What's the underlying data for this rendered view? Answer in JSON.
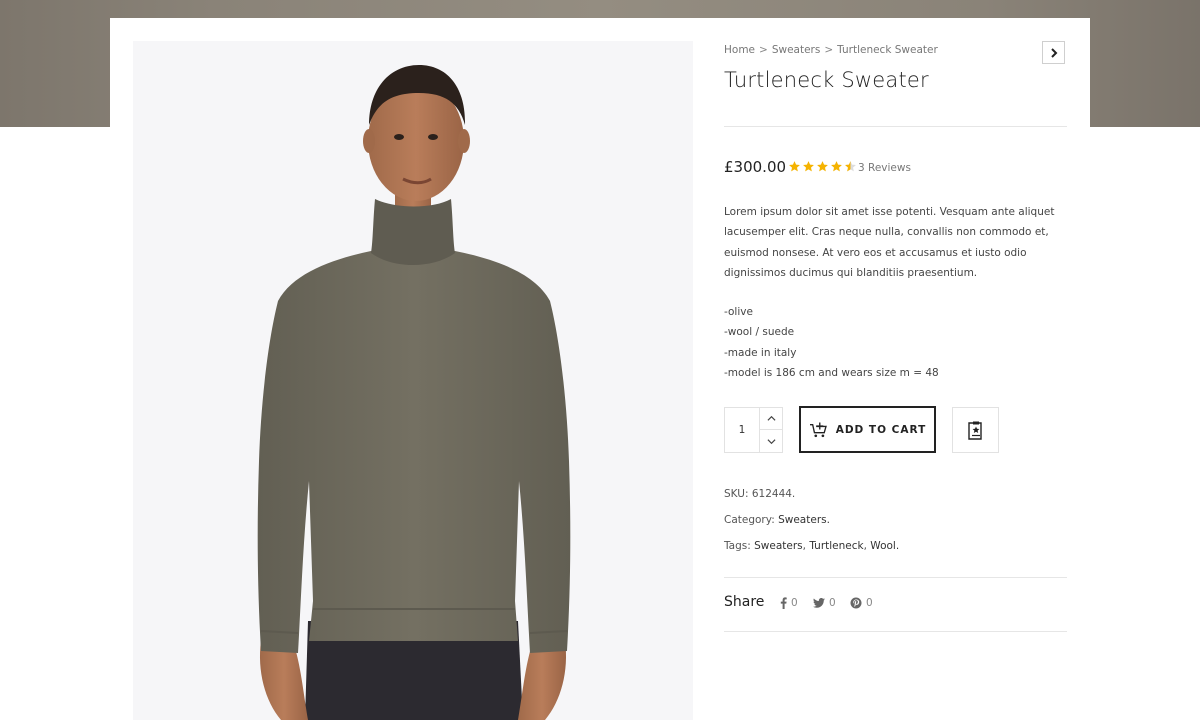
{
  "breadcrumb": {
    "items": [
      "Home",
      "Sweaters",
      "Turtleneck Sweater"
    ],
    "separator": ">"
  },
  "product": {
    "title": "Turtleneck Sweater",
    "price": "£300.00",
    "rating": 4.5,
    "rating_max": 5,
    "reviews": "3 Reviews",
    "description": "Lorem ipsum dolor sit amet isse potenti. Vesquam ante aliquet lacusemper elit. Cras neque nulla, convallis non commodo et, euismod nonsese. At vero eos et accusamus et iusto odio dignissimos ducimus qui blanditiis praesentium.",
    "features": [
      "-olive",
      "-wool / suede",
      "-made in italy",
      "-model is 186 cm and wears size m = 48"
    ],
    "quantity": "1",
    "add_to_cart_label": "ADD TO CART",
    "sku_label": "SKU:",
    "sku": "612444.",
    "category_label": "Category:",
    "category": "Sweaters.",
    "tags_label": "Tags:",
    "tags": [
      "Sweaters",
      "Turtleneck",
      "Wool."
    ]
  },
  "share": {
    "label": "Share",
    "facebook_count": "0",
    "twitter_count": "0",
    "pinterest_count": "0"
  },
  "icons": {
    "next": "chevron-right-icon",
    "cart": "cart-plus-icon",
    "wishlist": "clipboard-star-icon",
    "facebook": "facebook-icon",
    "twitter": "twitter-icon",
    "pinterest": "pinterest-icon"
  },
  "colors": {
    "star": "#f5b301",
    "sweater": "#6f6b5e",
    "hero_band": "#8a8378",
    "image_bg": "#f6f6f8"
  }
}
